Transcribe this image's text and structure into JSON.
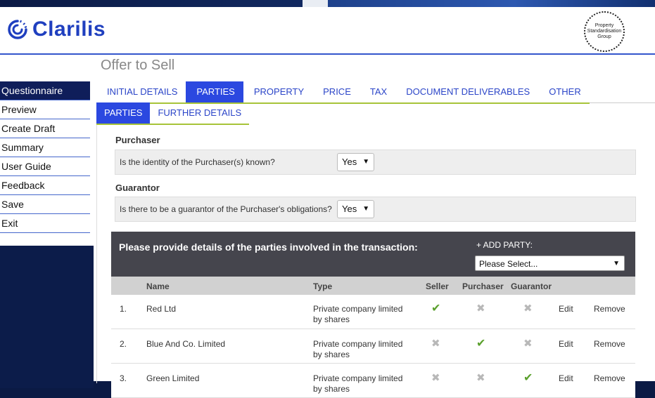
{
  "app": {
    "brand": "Clarilis",
    "seal_lines": [
      "Property",
      "Standardisation",
      "Group"
    ]
  },
  "colors": {
    "brand_blue": "#1f3fbf",
    "tab_active": "#2b48e0",
    "nav_active": "#0f1e5a",
    "accent_green": "#a7c438",
    "panel_dark": "#45454d",
    "tick_green": "#5aa02c"
  },
  "sidebar": {
    "items": [
      {
        "label": "Questionnaire",
        "active": true
      },
      {
        "label": "Preview"
      },
      {
        "label": "Create Draft"
      },
      {
        "label": "Summary"
      },
      {
        "label": "User Guide"
      },
      {
        "label": "Feedback"
      },
      {
        "label": "Save"
      },
      {
        "label": "Exit"
      }
    ]
  },
  "page": {
    "title": "Offer to Sell"
  },
  "tabs": [
    {
      "label": "INITIAL DETAILS"
    },
    {
      "label": "PARTIES",
      "active": true
    },
    {
      "label": "PROPERTY"
    },
    {
      "label": "PRICE"
    },
    {
      "label": "TAX"
    },
    {
      "label": "DOCUMENT DELIVERABLES"
    },
    {
      "label": "OTHER"
    }
  ],
  "subtabs": [
    {
      "label": "PARTIES",
      "active": true
    },
    {
      "label": "FURTHER DETAILS"
    }
  ],
  "purchaser": {
    "label": "Purchaser",
    "question": "Is the identity of the Purchaser(s) known?",
    "answer": "Yes"
  },
  "guarantor": {
    "label": "Guarantor",
    "question": "Is there to be a guarantor of the Purchaser's obligations?",
    "answer": "Yes"
  },
  "parties": {
    "title": "Please provide details of the parties involved in the transaction:",
    "add_label": "+ ADD PARTY:",
    "add_placeholder": "Please Select...",
    "columns": {
      "name": "Name",
      "type": "Type",
      "seller": "Seller",
      "purchaser": "Purchaser",
      "guarantor": "Guarantor"
    },
    "edit_label": "Edit",
    "remove_label": "Remove",
    "rows": [
      {
        "num": "1.",
        "name": "Red Ltd",
        "type_line1": "Private company limited",
        "type_line2": "by shares",
        "seller": true,
        "purchaser": false,
        "guarantor": false
      },
      {
        "num": "2.",
        "name": "Blue And Co. Limited",
        "type_line1": "Private company limited",
        "type_line2": "by shares",
        "seller": false,
        "purchaser": true,
        "guarantor": false
      },
      {
        "num": "3.",
        "name": "Green Limited",
        "type_line1": "Private company limited",
        "type_line2": "by shares",
        "seller": false,
        "purchaser": false,
        "guarantor": true
      }
    ]
  }
}
